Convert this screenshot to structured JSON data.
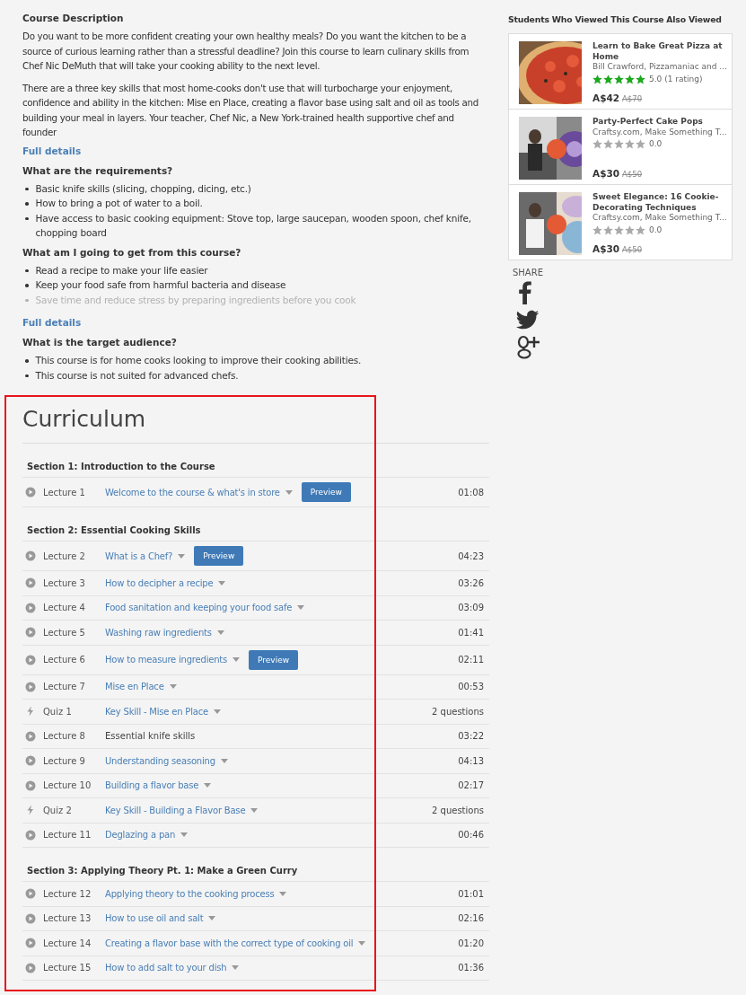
{
  "description": {
    "heading": "Course Description",
    "paragraphs": [
      "Do you want to be more confident creating your own healthy meals? Do you want the kitchen to be a source of curious learning rather than a stressful deadline? Join this course to learn culinary skills from Chef Nic DeMuth that will take your cooking ability to the next level.",
      "There are a three key skills that most home-cooks don't use that will turbocharge your enjoyment, confidence and ability in the kitchen: Mise en Place, creating a flavor base using salt and oil as tools and building your meal in layers. Your teacher, Chef Nic, a New York-trained health supportive chef and founder"
    ],
    "more_link": "Full details"
  },
  "requirements": {
    "heading": "What are the requirements?",
    "items": [
      {
        "text": "Basic knife skills (slicing, chopping, dicing, etc.)",
        "faded": false
      },
      {
        "text": "How to bring a pot of water to a boil.",
        "faded": false
      },
      {
        "text": "Have access to basic cooking equipment: Stove top, large saucepan, wooden spoon, chef knife, chopping board",
        "faded": false
      }
    ]
  },
  "outcomes": {
    "heading": "What am I going to get from this course?",
    "items": [
      {
        "text": "Read a recipe to make your life easier",
        "faded": false
      },
      {
        "text": "Keep your food safe from harmful bacteria and disease",
        "faded": false
      },
      {
        "text": "Save time and reduce stress by preparing ingredients before you cook",
        "faded": true
      }
    ],
    "more_link": "Full details"
  },
  "audience": {
    "heading": "What is the target audience?",
    "items": [
      {
        "text": "This course is for home cooks looking to improve their cooking abilities.",
        "faded": false
      },
      {
        "text": "This course is not suited for advanced chefs.",
        "faded": false
      }
    ]
  },
  "curriculum": {
    "title": "Curriculum",
    "sections": [
      {
        "title": "Section 1: Introduction to the Course",
        "items": [
          {
            "kind": "lecture",
            "label": "Lecture 1",
            "title": "Welcome to the course & what's in store",
            "expandable": true,
            "preview": "Preview",
            "duration": "01:08"
          }
        ]
      },
      {
        "title": "Section 2: Essential Cooking Skills",
        "items": [
          {
            "kind": "lecture",
            "label": "Lecture 2",
            "title": "What is a Chef?",
            "expandable": true,
            "preview": "Preview",
            "duration": "04:23"
          },
          {
            "kind": "lecture",
            "label": "Lecture 3",
            "title": "How to decipher a recipe",
            "expandable": true,
            "duration": "03:26"
          },
          {
            "kind": "lecture",
            "label": "Lecture 4",
            "title": "Food sanitation and keeping your food safe",
            "expandable": true,
            "duration": "03:09"
          },
          {
            "kind": "lecture",
            "label": "Lecture 5",
            "title": "Washing raw ingredients",
            "expandable": true,
            "duration": "01:41"
          },
          {
            "kind": "lecture",
            "label": "Lecture 6",
            "title": "How to measure ingredients",
            "expandable": true,
            "preview": "Preview",
            "duration": "02:11"
          },
          {
            "kind": "lecture",
            "label": "Lecture 7",
            "title": "Mise en Place",
            "expandable": true,
            "duration": "00:53"
          },
          {
            "kind": "quiz",
            "label": "Quiz 1",
            "title": "Key Skill - Mise en Place",
            "expandable": true,
            "duration": "2 questions"
          },
          {
            "kind": "lecture",
            "label": "Lecture 8",
            "title": "Essential knife skills",
            "expandable": false,
            "duration": "03:22"
          },
          {
            "kind": "lecture",
            "label": "Lecture 9",
            "title": "Understanding seasoning",
            "expandable": true,
            "duration": "04:13"
          },
          {
            "kind": "lecture",
            "label": "Lecture 10",
            "title": "Building a flavor base",
            "expandable": true,
            "duration": "02:17"
          },
          {
            "kind": "quiz",
            "label": "Quiz 2",
            "title": "Key Skill - Building a Flavor Base",
            "expandable": true,
            "duration": "2 questions"
          },
          {
            "kind": "lecture",
            "label": "Lecture 11",
            "title": "Deglazing a pan",
            "expandable": true,
            "duration": "00:46"
          }
        ]
      },
      {
        "title": "Section 3: Applying Theory Pt. 1: Make a Green Curry",
        "items": [
          {
            "kind": "lecture",
            "label": "Lecture 12",
            "title": "Applying theory to the cooking process",
            "expandable": true,
            "duration": "01:01"
          },
          {
            "kind": "lecture",
            "label": "Lecture 13",
            "title": "How to use oil and salt",
            "expandable": true,
            "duration": "02:16"
          },
          {
            "kind": "lecture",
            "label": "Lecture 14",
            "title": "Creating a flavor base with the correct type of cooking oil",
            "expandable": true,
            "duration": "01:20"
          },
          {
            "kind": "lecture",
            "label": "Lecture 15",
            "title": "How to add salt to your dish",
            "expandable": true,
            "duration": "01:36"
          }
        ]
      }
    ]
  },
  "sidebar": {
    "heading": "Students Who Viewed This Course Also Viewed",
    "courses": [
      {
        "title": "Learn to Bake Great Pizza at Home",
        "author": "Bill Crawford, Pizzamaniac and ...",
        "stars": 5,
        "rating": "5.0 (1 rating)",
        "price": "A$42",
        "old_price": "A$70"
      },
      {
        "title": "Party-Perfect Cake Pops",
        "author": "Craftsy.com, Make Something T...",
        "stars": 0,
        "rating": "0.0",
        "price": "A$30",
        "old_price": "A$50"
      },
      {
        "title": "Sweet Elegance: 16 Cookie-Decorating Techniques",
        "author": "Craftsy.com, Make Something T...",
        "stars": 0,
        "rating": "0.0",
        "price": "A$30",
        "old_price": "A$50"
      }
    ],
    "share": {
      "label": "SHARE"
    }
  }
}
